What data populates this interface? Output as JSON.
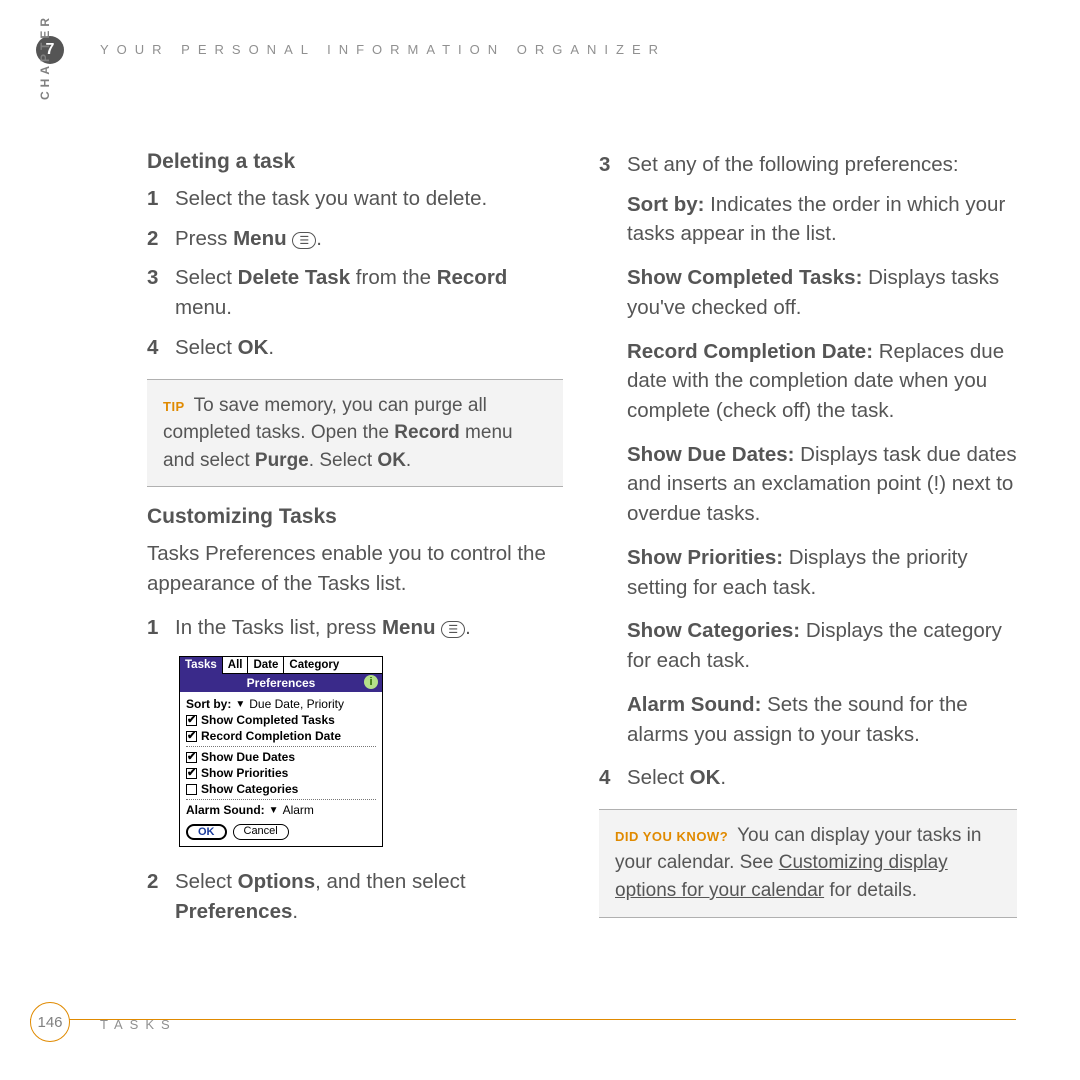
{
  "header": {
    "chapter_number": "7",
    "chapter_label": "CHAPTER",
    "title": "YOUR PERSONAL INFORMATION ORGANIZER"
  },
  "left": {
    "deleting_heading": "Deleting a task",
    "del_steps": {
      "s1": "Select the task you want to delete.",
      "s2_a": "Press ",
      "s2_b": "Menu",
      "s2_c": " ",
      "s2_icon": "☰",
      "s2_d": ".",
      "s3_a": "Select ",
      "s3_b": "Delete Task",
      "s3_c": " from the ",
      "s3_d": "Record",
      "s3_e": " menu.",
      "s4_a": "Select ",
      "s4_b": "OK",
      "s4_c": "."
    },
    "tip": {
      "label": "TIP",
      "t1": " To save memory, you can purge all completed tasks. Open the ",
      "t2": "Record",
      "t3": " menu and select ",
      "t4": "Purge",
      "t5": ". Select ",
      "t6": "OK",
      "t7": "."
    },
    "custom_heading": "Customizing Tasks",
    "custom_intro": "Tasks Preferences enable you to control the appearance of the Tasks list.",
    "c1_a": "In the Tasks list, press ",
    "c1_b": "Menu",
    "c1_icon": "☰",
    "c1_c": ".",
    "shot": {
      "tab_tasks": "Tasks",
      "tab_all": "All",
      "tab_date": "Date",
      "tab_cat": "Category",
      "subbar": "Preferences",
      "info": "i",
      "sort_label": "Sort by:",
      "sort_val": "Due Date, Priority",
      "opt1": "Show Completed Tasks",
      "opt2": "Record Completion Date",
      "opt3": "Show Due Dates",
      "opt4": "Show Priorities",
      "opt5": "Show Categories",
      "alarm_label": "Alarm Sound:",
      "alarm_val": "Alarm",
      "ok": "OK",
      "cancel": "Cancel"
    },
    "c2_a": "Select ",
    "c2_b": "Options",
    "c2_c": ", and then select ",
    "c2_d": "Preferences",
    "c2_e": "."
  },
  "right": {
    "s3_intro": "Set any of the following preferences:",
    "prefs": {
      "sortby_b": "Sort by:",
      "sortby_t": " Indicates the order in which your tasks appear in the list.",
      "completed_b": "Show Completed Tasks:",
      "completed_t": " Displays tasks you've checked off.",
      "reccomp_b": "Record Completion Date:",
      "reccomp_t": " Replaces due date with the completion date when you complete (check off) the task.",
      "duedates_b": "Show Due Dates:",
      "duedates_t": " Displays task due dates and inserts an exclamation point (!) next to overdue tasks.",
      "prio_b": "Show Priorities:",
      "prio_t": " Displays the priority setting for each task.",
      "cat_b": "Show Categories:",
      "cat_t": " Displays the category for each task.",
      "alarm_b": "Alarm Sound:",
      "alarm_t": " Sets the sound for the alarms you assign to your tasks."
    },
    "s4_a": "Select ",
    "s4_b": "OK",
    "s4_c": ".",
    "dyk": {
      "label": "DID YOU KNOW?",
      "t1": " You can display your tasks in your calendar. See ",
      "link": "Customizing display options for your calendar",
      "t2": " for details."
    }
  },
  "footer": {
    "page": "146",
    "section": "TASKS"
  }
}
